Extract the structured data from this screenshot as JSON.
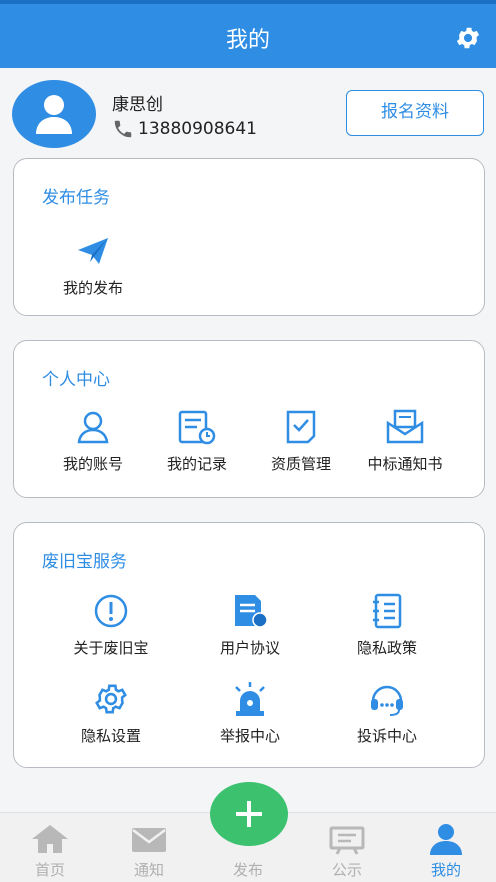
{
  "header": {
    "title": "我的",
    "settings_icon": "gear-icon"
  },
  "profile": {
    "name": "康思创",
    "phone": "13880908641",
    "register_button": "报名资料"
  },
  "publish": {
    "title": "发布任务",
    "items": [
      {
        "label": "我的发布",
        "icon": "paper-plane-icon"
      }
    ]
  },
  "personal": {
    "title": "个人中心",
    "items": [
      {
        "label": "我的账号",
        "icon": "user-icon"
      },
      {
        "label": "我的记录",
        "icon": "record-icon"
      },
      {
        "label": "资质管理",
        "icon": "qualification-icon"
      },
      {
        "label": "中标通知书",
        "icon": "envelope-icon"
      }
    ]
  },
  "service": {
    "title": "废旧宝服务",
    "items": [
      {
        "label": "关于废旧宝",
        "icon": "info-icon"
      },
      {
        "label": "用户协议",
        "icon": "agreement-icon"
      },
      {
        "label": "隐私政策",
        "icon": "notebook-icon"
      },
      {
        "label": "隐私设置",
        "icon": "settings-icon"
      },
      {
        "label": "举报中心",
        "icon": "siren-icon"
      },
      {
        "label": "投诉中心",
        "icon": "headset-icon"
      }
    ]
  },
  "tabs": [
    {
      "label": "首页",
      "icon": "home-icon"
    },
    {
      "label": "通知",
      "icon": "mail-icon"
    },
    {
      "label": "发布",
      "icon": "plus-icon"
    },
    {
      "label": "公示",
      "icon": "board-icon"
    },
    {
      "label": "我的",
      "icon": "person-icon",
      "active": true
    }
  ],
  "colors": {
    "primary": "#2f8de4",
    "fab": "#3cc26e",
    "inactive": "#b0b0b0"
  }
}
